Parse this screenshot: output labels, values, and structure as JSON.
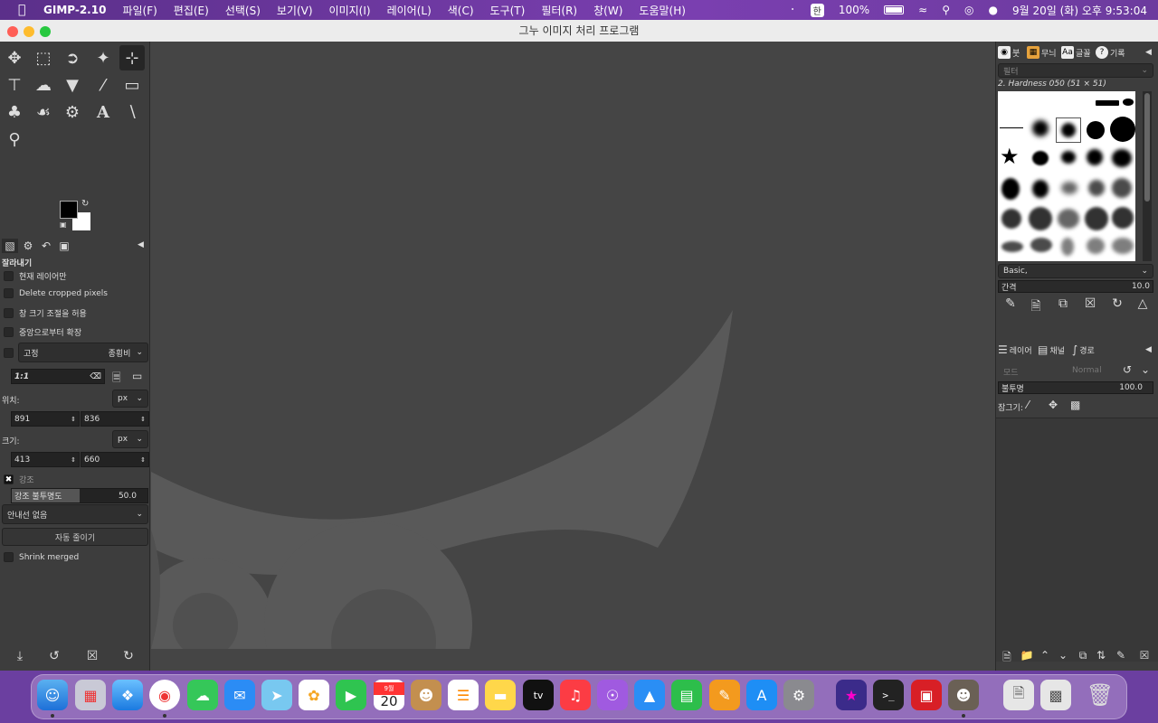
{
  "menubar": {
    "app": "GIMP-2.10",
    "items": [
      "파일(F)",
      "편집(E)",
      "선택(S)",
      "보기(V)",
      "이미지(I)",
      "레이어(L)",
      "색(C)",
      "도구(T)",
      "필터(R)",
      "창(W)",
      "도움말(H)"
    ],
    "input_badge": "한",
    "battery": "100%",
    "datetime": "9월 20일 (화) 오후 9:53:04"
  },
  "window": {
    "title": "그누 이미지 처리 프로그램"
  },
  "tool_options": {
    "title": "잘라내기",
    "current_layer_only": "현재 레이어만",
    "delete_cropped": "Delete cropped pixels",
    "allow_growing": "창 크기 조절을 허용",
    "expand_center": "중앙으로부터 확장",
    "fixed_label": "고정",
    "fixed_mode": "종횡비",
    "ratio_value": "1:1",
    "position_label": "위치:",
    "position_unit": "px",
    "pos_x": "891",
    "pos_y": "836",
    "size_label": "크기:",
    "size_unit": "px",
    "size_w": "413",
    "size_h": "660",
    "highlight_label": "강조",
    "highlight_opacity_label": "강조 불투명도",
    "highlight_opacity_value": "50.0",
    "highlight_opacity_fraction": 0.5,
    "guides": "안내선 없음",
    "auto_shrink": "자동 줄이기",
    "shrink_merged": "Shrink merged"
  },
  "brushes": {
    "tabs": [
      "붓",
      "무늬",
      "글꼴",
      "기록"
    ],
    "filter_placeholder": "필터",
    "selected_name": "2. Hardness 050 (51 × 51)",
    "tag": "Basic,",
    "spacing_label": "간격",
    "spacing_value": "10.0"
  },
  "layers": {
    "tabs": [
      "레이어",
      "채널",
      "경로"
    ],
    "mode_label": "모드",
    "mode_value": "Normal",
    "opacity_label": "불투명",
    "opacity_value": "100.0",
    "lock_label": "잠그기:"
  },
  "dock": {
    "calendar_month": "9월",
    "calendar_day": "20",
    "tv_label": "tv"
  }
}
